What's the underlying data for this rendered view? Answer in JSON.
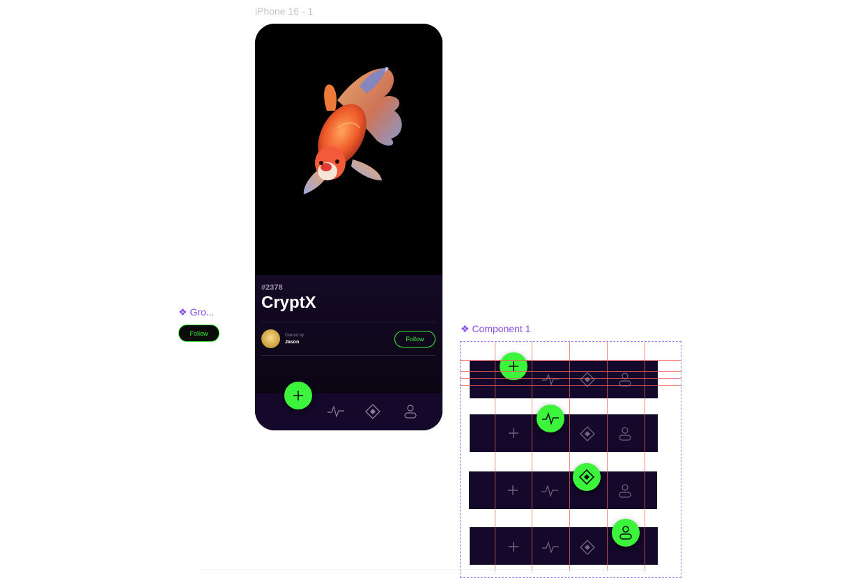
{
  "frame_title": "iPhone 16 - 1",
  "phone": {
    "token_id": "#2378",
    "token_name": "CryptX",
    "owned_by_label": "Owned by",
    "owner_name": "Jason",
    "follow_label": "Follow",
    "nav_items": [
      "plus-icon",
      "activity-icon",
      "diamond-icon",
      "user-icon"
    ],
    "active_nav": 0
  },
  "group_component": {
    "label": "❖ Gro...",
    "follow_label": "Follow"
  },
  "component_1": {
    "label": "❖ Component 1",
    "variants": [
      {
        "active": "plus-icon"
      },
      {
        "active": "activity-icon"
      },
      {
        "active": "diamond-icon"
      },
      {
        "active": "user-icon"
      }
    ]
  },
  "colors": {
    "accent_green": "#3cf43c",
    "nav_background": "#14092a",
    "component_label": "#8a4bea",
    "layout_grid": "#ef5f5f"
  }
}
